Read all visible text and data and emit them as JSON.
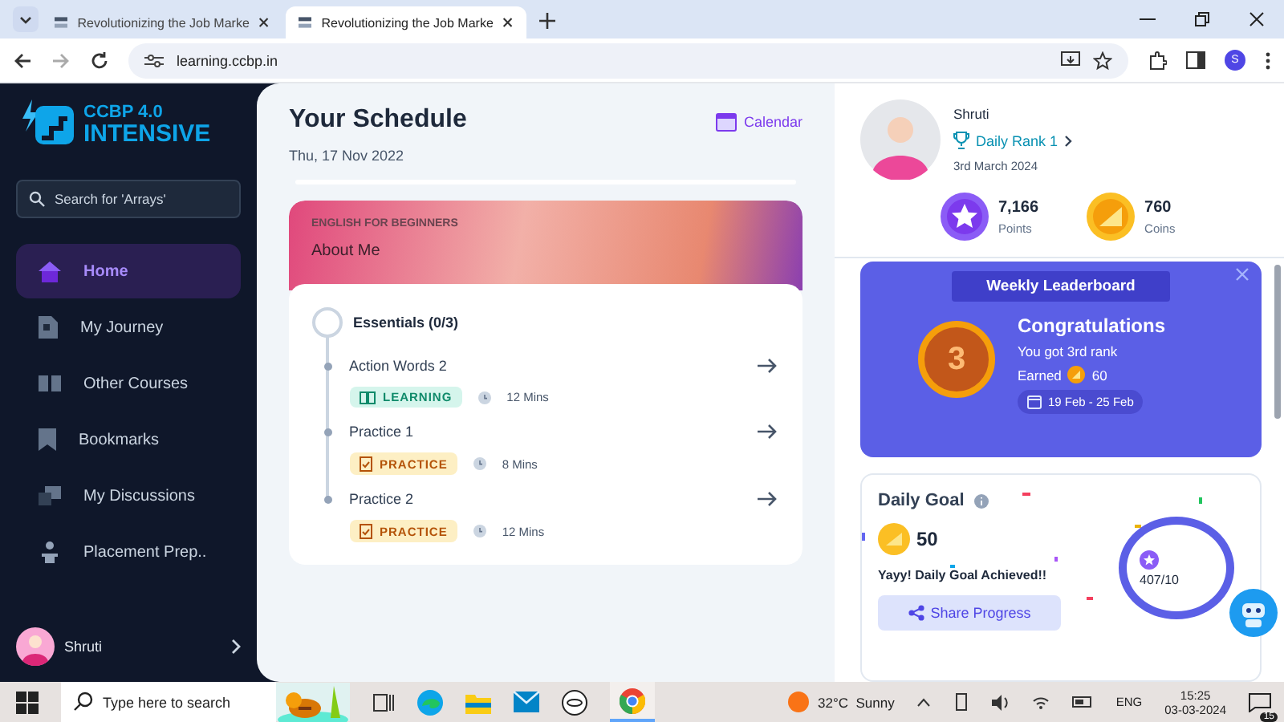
{
  "browser": {
    "tabs": [
      {
        "title": "Revolutionizing the Job Marke",
        "selected": false
      },
      {
        "title": "Revolutionizing the Job Marke",
        "selected": true
      }
    ],
    "url": "learning.ccbp.in",
    "profile_initial": "S"
  },
  "sidebar": {
    "logo_top": "CCBP 4.0",
    "logo_bottom": "INTENSIVE",
    "search": {
      "placeholder": "Search for 'Arrays'"
    },
    "items": [
      {
        "label": "Home",
        "selected": true
      },
      {
        "label": "My Journey",
        "selected": false
      },
      {
        "label": "Other Courses",
        "selected": false
      },
      {
        "label": "Bookmarks",
        "selected": false
      },
      {
        "label": "My Discussions",
        "selected": false
      },
      {
        "label": "Placement Prep..",
        "selected": false
      }
    ],
    "user": "Shruti"
  },
  "schedule": {
    "title": "Your Schedule",
    "date": "Thu, 17 Nov 2022",
    "calendar_link": "Calendar",
    "course": {
      "category": "ENGLISH FOR BEGINNERS",
      "topic": "About Me",
      "section": "Essentials (0/3)",
      "items": [
        {
          "title": "Action Words 2",
          "kind": "learning",
          "tag": "LEARNING",
          "duration": "12 Mins"
        },
        {
          "title": "Practice 1",
          "kind": "practice",
          "tag": "PRACTICE",
          "duration": "8 Mins"
        },
        {
          "title": "Practice 2",
          "kind": "practice",
          "tag": "PRACTICE",
          "duration": "12 Mins"
        }
      ]
    }
  },
  "profile": {
    "name": "Shruti",
    "rank": "Daily Rank 1",
    "date": "3rd March 2024",
    "stats": [
      {
        "kind": "points",
        "value": "7,166",
        "label": "Points"
      },
      {
        "kind": "coins",
        "value": "760",
        "label": "Coins"
      }
    ]
  },
  "leaderboard": {
    "title": "Weekly Leaderboard",
    "medal": "3",
    "heading": "Congratulations",
    "message": "You got 3rd rank",
    "earned_label": "Earned",
    "earned": "60",
    "range": "19 Feb - 25 Feb"
  },
  "daily_goal": {
    "title": "Daily Goal",
    "coins": "50",
    "message": "Yayy! Daily Goal Achieved!!",
    "share": "Share Progress",
    "progress": "407/10"
  },
  "taskbar": {
    "search": {
      "placeholder": "Type here to search"
    },
    "weather": "32°C  Sunny",
    "language": "ENG",
    "time": "15:25",
    "date": "03-03-2024",
    "notifications": "15"
  }
}
